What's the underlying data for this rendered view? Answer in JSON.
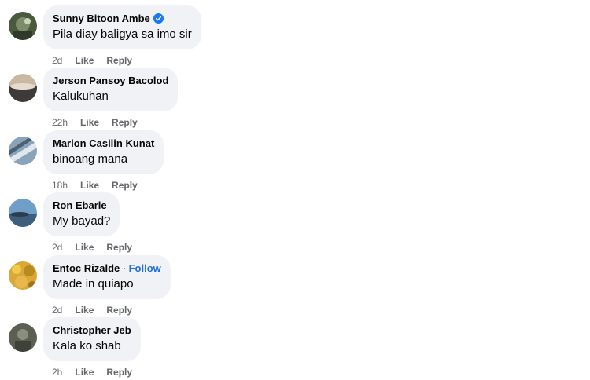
{
  "comments": [
    {
      "author": "Sunny Bitoon Ambe",
      "verified": true,
      "text": "Pila diay baligya sa imo sir",
      "time": "2d",
      "like": "Like",
      "reply": "Reply"
    },
    {
      "author": "Jerson Pansoy Bacolod",
      "text": "Kalukuhan",
      "time": "22h",
      "like": "Like",
      "reply": "Reply"
    },
    {
      "author": "Marlon Casilin Kunat",
      "text": "binoang mana",
      "time": "18h",
      "like": "Like",
      "reply": "Reply"
    },
    {
      "author": "Ron Ebarle",
      "text": "My bayad?",
      "time": "2d",
      "like": "Like",
      "reply": "Reply"
    },
    {
      "author": "Entoc Rizalde",
      "separator": "·",
      "follow": "Follow",
      "text": "Made in quiapo",
      "time": "2d",
      "like": "Like",
      "reply": "Reply"
    },
    {
      "author": "Christopher Jeb",
      "text": "Kala ko shab",
      "time": "2h",
      "like": "Like",
      "reply": "Reply"
    }
  ],
  "colors": {
    "bubble": "#f0f2f5",
    "meta_text": "#65676b",
    "follow_link": "#216fdb",
    "verified_badge": "#1877f2"
  }
}
